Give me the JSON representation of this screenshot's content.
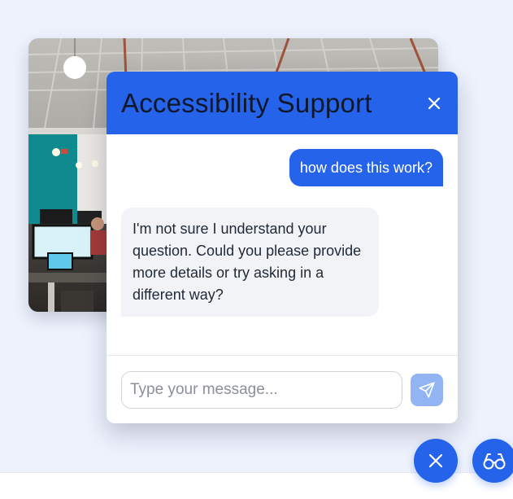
{
  "chat": {
    "title": "Accessibility Support",
    "messages": [
      {
        "role": "user",
        "text": "how does this work?"
      },
      {
        "role": "assistant",
        "text": "I'm not sure I understand your question. Could you please provide more details or try asking in a different way?"
      }
    ],
    "input": {
      "placeholder": "Type your message...",
      "value": ""
    }
  },
  "colors": {
    "accent": "#2563eb",
    "send_disabled": "#93b4f2",
    "bot_bubble": "#f1f3f6",
    "page_background": "#eef2fd"
  },
  "icons": {
    "header_close": "close-icon",
    "send": "send-icon",
    "fab_close": "close-icon",
    "fab_accessibility": "glasses-icon"
  }
}
